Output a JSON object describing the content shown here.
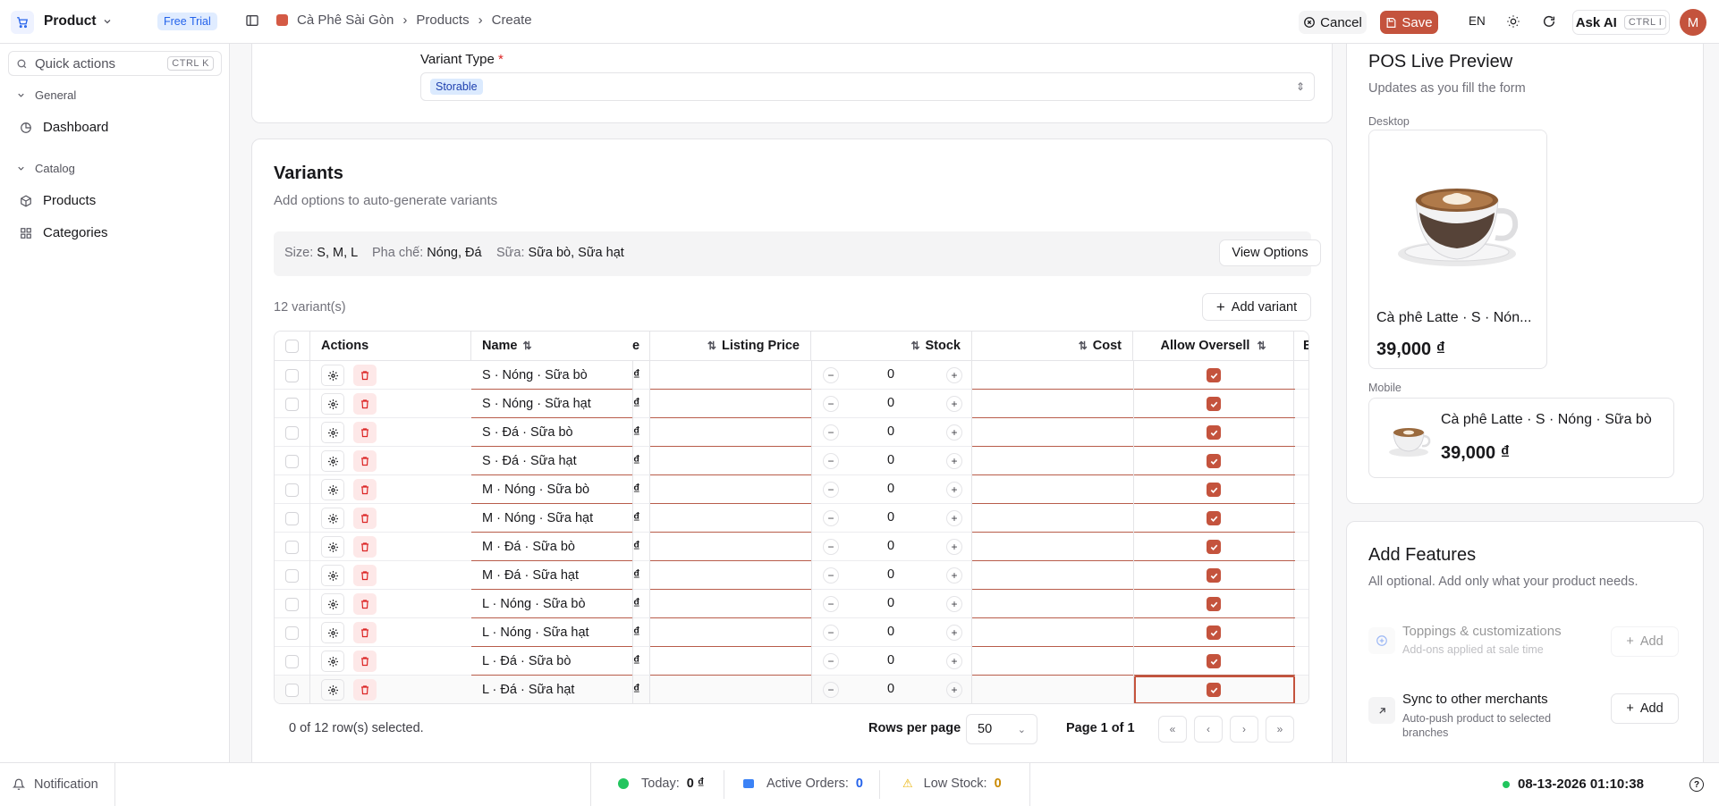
{
  "header": {
    "app_name": "Product",
    "badge": "Free Trial",
    "breadcrumb": [
      "Cà Phê Sài Gòn",
      "Products",
      "Create"
    ],
    "cancel": "Cancel",
    "save": "Save",
    "lang": "EN",
    "ask_ai": "Ask AI",
    "ask_ai_kbd": "CTRL I",
    "avatar": "M"
  },
  "sidebar": {
    "quick_actions": "Quick actions",
    "quick_kbd": "CTRL K",
    "groups": [
      {
        "label": "General",
        "items": [
          {
            "label": "Dashboard",
            "icon": "clock-pie-icon"
          }
        ]
      },
      {
        "label": "Catalog",
        "items": [
          {
            "label": "Products",
            "icon": "box-icon"
          },
          {
            "label": "Categories",
            "icon": "grid-icon"
          }
        ]
      }
    ]
  },
  "variant_type": {
    "label": "Variant Type",
    "required": "*",
    "value": "Storable"
  },
  "variants": {
    "title": "Variants",
    "subtitle": "Add options to auto-generate variants",
    "options": [
      {
        "key": "Size:",
        "val": "S, M, L"
      },
      {
        "key": "Pha chế:",
        "val": "Nóng, Đá"
      },
      {
        "key": "Sữa:",
        "val": "Sữa bò, Sữa hạt"
      }
    ],
    "view_options": "View Options",
    "count": "12 variant(s)",
    "add_variant": "Add variant"
  },
  "table": {
    "columns": {
      "actions": "Actions",
      "name": "Name",
      "prev": "e",
      "listing": "Listing Price",
      "stock": "Stock",
      "cost": "Cost",
      "oversell": "Allow Oversell",
      "next": "E"
    },
    "rows": [
      {
        "name": "S · Nóng · Sữa bò",
        "price_frag": "₫",
        "stock": "0"
      },
      {
        "name": "S · Nóng · Sữa hạt",
        "price_frag": "₫",
        "stock": "0"
      },
      {
        "name": "S · Đá · Sữa bò",
        "price_frag": "₫",
        "stock": "0"
      },
      {
        "name": "S · Đá · Sữa hạt",
        "price_frag": "₫",
        "stock": "0"
      },
      {
        "name": "M · Nóng · Sữa bò",
        "price_frag": "₫",
        "stock": "0"
      },
      {
        "name": "M · Nóng · Sữa hạt",
        "price_frag": "₫",
        "stock": "0"
      },
      {
        "name": "M · Đá · Sữa bò",
        "price_frag": "₫",
        "stock": "0"
      },
      {
        "name": "M · Đá · Sữa hạt",
        "price_frag": "₫",
        "stock": "0"
      },
      {
        "name": "L · Nóng · Sữa bò",
        "price_frag": "₫",
        "stock": "0"
      },
      {
        "name": "L · Nóng · Sữa hạt",
        "price_frag": "₫",
        "stock": "0"
      },
      {
        "name": "L · Đá · Sữa bò",
        "price_frag": "₫",
        "stock": "0"
      },
      {
        "name": "L · Đá · Sữa hạt",
        "price_frag": "₫",
        "stock": "0"
      }
    ],
    "selected": "0 of 12 row(s) selected.",
    "rows_per_page_label": "Rows per page",
    "rows_per_page": "50",
    "page": "Page 1 of 1"
  },
  "preview": {
    "title": "POS Live Preview",
    "subtitle": "Updates as you fill the form",
    "desktop_label": "Desktop",
    "desktop_name": "Cà phê Latte · S · Nón...",
    "desktop_price": "39,000 ₫",
    "mobile_label": "Mobile",
    "mobile_name": "Cà phê Latte · S · Nóng · Sữa bò",
    "mobile_price": "39,000 ₫"
  },
  "features": {
    "title": "Add Features",
    "subtitle": "All optional. Add only what your product needs.",
    "items": [
      {
        "title": "Toppings & customizations",
        "desc": "Add-ons applied at sale time",
        "button": "Add",
        "disabled": true
      },
      {
        "title": "Sync to other merchants",
        "desc": "Auto-push product to selected branches",
        "button": "Add",
        "disabled": false
      }
    ]
  },
  "status": {
    "notification": "Notification",
    "today_label": "Today:",
    "today_value": "0 ₫",
    "orders_label": "Active Orders:",
    "orders_value": "0",
    "low_label": "Low Stock:",
    "low_value": "0",
    "datetime": "08-13-2026 01:10:38"
  },
  "colors": {
    "accent": "#c4533d",
    "badge_blue": "#2563eb",
    "green": "#22c55e"
  }
}
